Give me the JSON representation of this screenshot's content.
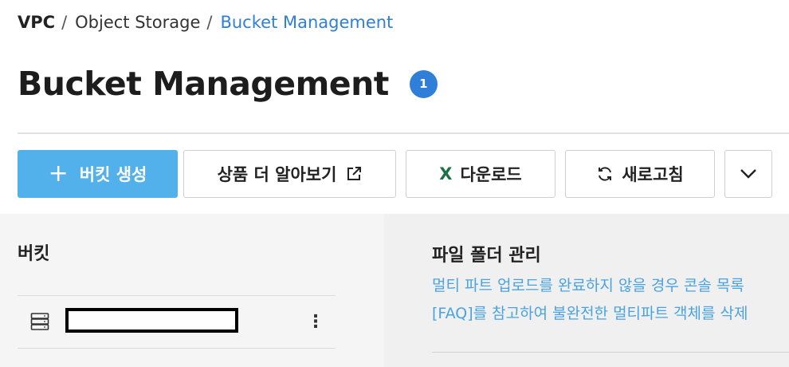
{
  "breadcrumb": {
    "root": "VPC",
    "separator": "/",
    "items": [
      "Object Storage"
    ],
    "current": "Bucket Management"
  },
  "header": {
    "title": "Bucket Management",
    "badge": "1"
  },
  "toolbar": {
    "create_label": "버킷 생성",
    "learn_label": "상품 더 알아보기",
    "download_label": "다운로드",
    "refresh_label": "새로고침"
  },
  "bucket_panel": {
    "heading": "버킷",
    "rows": [
      {
        "name": "",
        "icon": "storage-icon"
      }
    ]
  },
  "info_panel": {
    "heading": "파일 폴더 관리",
    "lines": [
      "멀티 파트 업로드를 완료하지 않을 경우 콘솔 목록",
      "[FAQ]를 참고하여 불완전한 멀티파트 객체를 삭제"
    ]
  },
  "colors": {
    "accent": "#2f7ed8",
    "primary_button": "#52b0ea",
    "help_text": "#4aa3e0",
    "excel_green": "#1e7145"
  },
  "icons": {
    "plus": "plus-icon",
    "external": "external-link-icon",
    "excel": "excel-icon",
    "refresh": "refresh-icon",
    "more": "chevron-down-icon",
    "row_menu": "kebab-menu-icon"
  }
}
